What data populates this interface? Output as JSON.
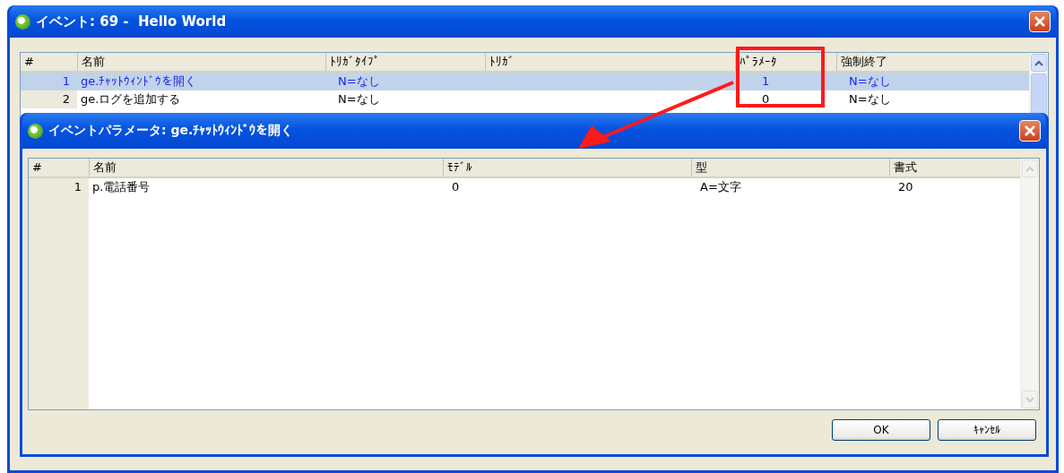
{
  "window": {
    "title": "イベント: 69 -  Hello World"
  },
  "event_table": {
    "columns": [
      "#",
      "名前",
      "ﾄﾘｶﾞﾀｲﾌﾟ",
      "ﾄﾘｶﾞ",
      "ﾊﾟﾗﾒｰﾀ",
      "強制終了"
    ],
    "rows": [
      {
        "cells": [
          "1",
          "ge.ﾁｬｯﾄｳｨﾝﾄﾞｳを開く",
          "N=なし",
          "",
          "1",
          "N=なし"
        ],
        "selected": true
      },
      {
        "cells": [
          "2",
          "ge.ログを追加する",
          "N=なし",
          "",
          "0",
          "N=なし"
        ],
        "selected": false
      }
    ]
  },
  "dialog": {
    "title": "イベントパラメータ: ge.ﾁｬｯﾄｳｨﾝﾄﾞｳを開く",
    "table": {
      "columns": [
        "#",
        "名前",
        "ﾓﾃﾞﾙ",
        "型",
        "書式"
      ],
      "rows": [
        {
          "cells": [
            "1",
            "p.電話番号",
            "0",
            "A=文字",
            "20"
          ],
          "selected": false
        }
      ]
    },
    "buttons": [
      "OK",
      "ｷｬﾝｾﾙ"
    ]
  }
}
